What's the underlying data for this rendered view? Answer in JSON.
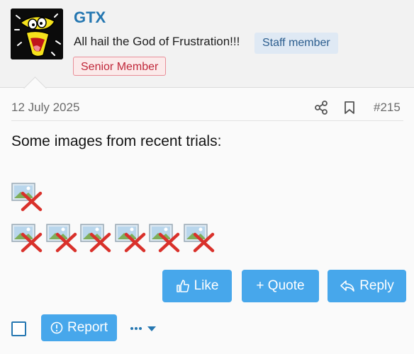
{
  "author": {
    "username": "GTX",
    "custom_title": "All hail the God of Frustration!!!",
    "badge_staff": "Staff member",
    "badge_rank": "Senior Member",
    "avatar_icon": "cartoon-duck-avatar"
  },
  "post": {
    "date": "12 July 2025",
    "number": "#215",
    "text": "Some images from recent trials:",
    "images_row1": [
      "broken-image-icon"
    ],
    "images_row2": [
      "broken-image-icon",
      "broken-image-icon",
      "broken-image-icon",
      "broken-image-icon",
      "broken-image-icon",
      "broken-image-icon"
    ]
  },
  "actions": {
    "like": "Like",
    "quote": "+ Quote",
    "reply": "Reply",
    "report": "Report"
  },
  "colors": {
    "accent": "#47a7eb",
    "username": "#2577b1",
    "staff_badge_bg": "#dfe9f4",
    "senior_badge_text": "#c0283a"
  }
}
